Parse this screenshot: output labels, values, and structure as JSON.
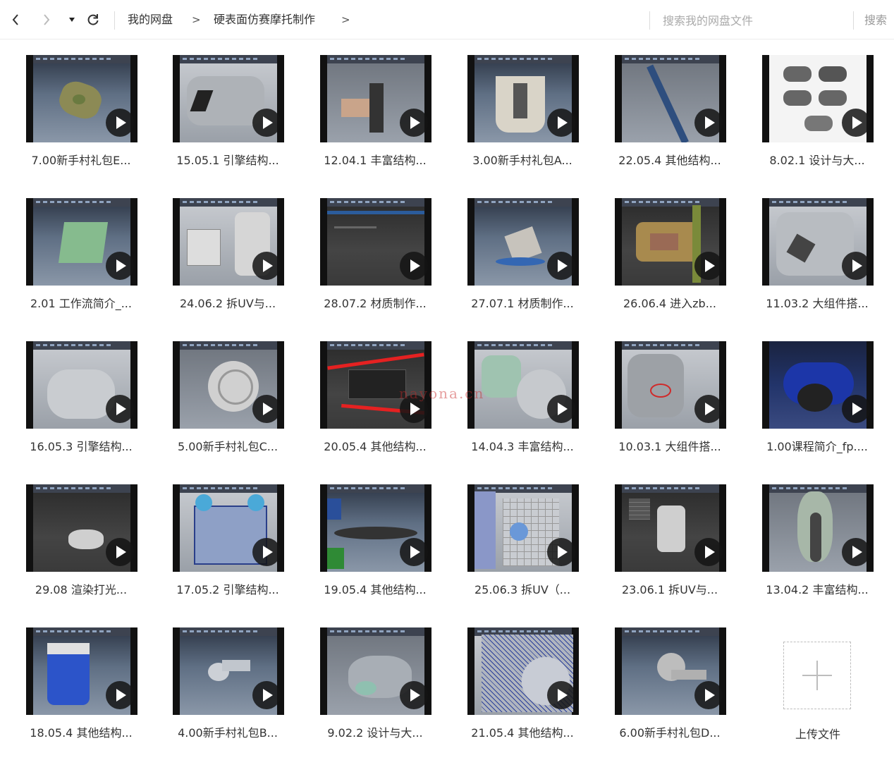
{
  "toolbar": {
    "breadcrumb": [
      "我的网盘",
      "硬表面仿赛摩托制作"
    ],
    "breadcrumb_separator": ">",
    "search_placeholder": "搜索我的网盘文件",
    "search_button": "搜索"
  },
  "files": [
    {
      "name": "7.00新手村礼包E...",
      "thumb": "gear"
    },
    {
      "name": "15.05.1 引擎结构...",
      "thumb": "engine"
    },
    {
      "name": "12.04.1 丰富结构...",
      "thumb": "part"
    },
    {
      "name": "3.00新手村礼包A...",
      "thumb": "cup"
    },
    {
      "name": "22.05.4 其他结构...",
      "thumb": "strip"
    },
    {
      "name": "8.02.1 设计与大...",
      "thumb": "bikes"
    },
    {
      "name": "2.01 工作流简介_...",
      "thumb": "box"
    },
    {
      "name": "24.06.2 拆UV与...",
      "thumb": "uv"
    },
    {
      "name": "28.07.2 材质制作...",
      "thumb": "dark"
    },
    {
      "name": "27.07.1 材质制作...",
      "thumb": "cube"
    },
    {
      "name": "26.06.4 进入zb...",
      "thumb": "color"
    },
    {
      "name": "11.03.2 大组件搭...",
      "thumb": "parts"
    },
    {
      "name": "16.05.3 引擎结构...",
      "thumb": "cyl"
    },
    {
      "name": "5.00新手村礼包C...",
      "thumb": "ring"
    },
    {
      "name": "20.05.4 其他结构...",
      "thumb": "redlines"
    },
    {
      "name": "14.04.3 丰富结构...",
      "thumb": "mech"
    },
    {
      "name": "10.03.1 大组件搭...",
      "thumb": "engine2"
    },
    {
      "name": "1.00课程简介_fp....",
      "thumb": "render"
    },
    {
      "name": "29.08 渲染打光...",
      "thumb": "darkobj"
    },
    {
      "name": "17.05.2 引擎结构...",
      "thumb": "blueprint"
    },
    {
      "name": "19.05.4 其他结构...",
      "thumb": "arch"
    },
    {
      "name": "25.06.3 拆UV（...",
      "thumb": "uvgrid"
    },
    {
      "name": "23.06.1 拆UV与...",
      "thumb": "can"
    },
    {
      "name": "13.04.2 丰富结构...",
      "thumb": "bikefront"
    },
    {
      "name": "18.05.4 其他结构...",
      "thumb": "bluepart"
    },
    {
      "name": "4.00新手村礼包B...",
      "thumb": "flat"
    },
    {
      "name": "9.02.2 设计与大...",
      "thumb": "sculpt"
    },
    {
      "name": "21.05.4 其他结构...",
      "thumb": "wire"
    },
    {
      "name": "6.00新手村礼包D...",
      "thumb": "knob"
    }
  ],
  "upload": {
    "label": "上传文件"
  },
  "watermark": "nayona.cn"
}
